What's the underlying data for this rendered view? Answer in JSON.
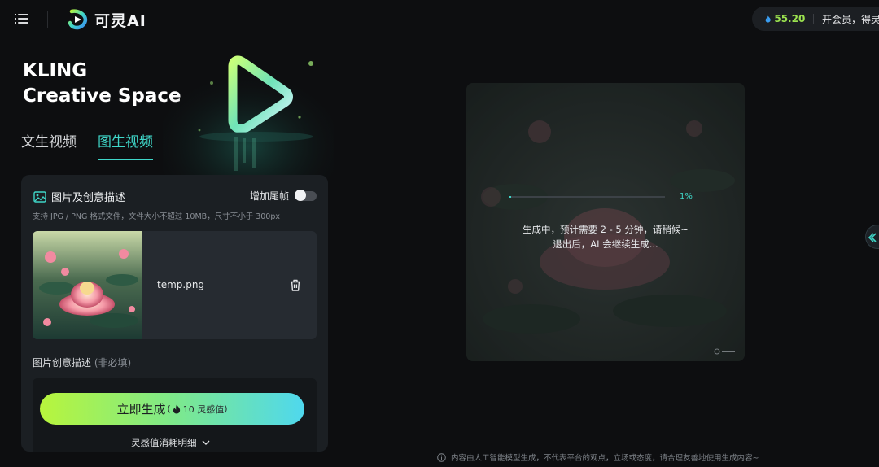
{
  "header": {
    "brand": "可灵AI",
    "points": "55.20",
    "member_cta": "开会员，得灵感"
  },
  "hero": {
    "line1": "KLING",
    "line2": "Creative Space"
  },
  "tabs": [
    {
      "label": "文生视频",
      "active": false
    },
    {
      "label": "图生视频",
      "active": true
    }
  ],
  "panel": {
    "section_label": "图片及创意描述",
    "tail_frame_label": "增加尾帧",
    "tail_frame_on": false,
    "hint": "支持 JPG / PNG 格式文件，文件大小不超过 10MB，尺寸不小于 300px",
    "file_name": "temp.png",
    "desc_label": "图片创意描述",
    "desc_optional": "(非必填)"
  },
  "generate": {
    "label": "立即生成",
    "cost_open": "(",
    "cost": "10 灵感值",
    "cost_close": ")"
  },
  "detail_link": "灵感值消耗明细",
  "preview": {
    "progress": 0.01,
    "percent_label": "1%",
    "status_line1": "生成中，预计需要 2 - 5 分钟，请稍候~",
    "status_line2": "退出后，AI 会继续生成..."
  },
  "disclaimer": "内容由人工智能模型生成，不代表平台的观点，立场或态度，请合理友善地使用生成内容~",
  "colors": {
    "accent": "#3fd6c8",
    "points": "#9be24f",
    "background": "#0d0e10"
  }
}
